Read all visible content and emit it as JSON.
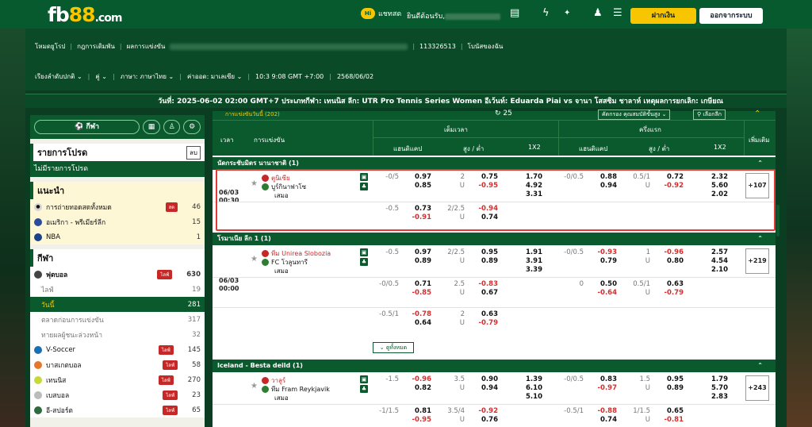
{
  "header": {
    "logo_prefix": "fb",
    "logo_num": "88",
    "logo_suffix": ".com",
    "chat_bubble": "Hi",
    "chat_label": "แชทสด",
    "welcome": "ยินดีต้อนรับ,",
    "deposit_label": "ฝากเงิน",
    "logout_label": "ออกจากระบบ",
    "icons": [
      "wallet-icon",
      "bolt-icon",
      "promo-icon",
      "user-icon",
      "list-icon",
      "menu-icon"
    ]
  },
  "nav": {
    "row1": [
      "โหมดยูโรป",
      "กฎการเดิมพัน",
      "ผลการแข่งขัน"
    ],
    "account_id": "113326513",
    "my_bets": "โบนัสของฉัน",
    "row2": [
      "เรียงลำดับปกติ",
      "คู่",
      "ภาษา: ภาษาไทย",
      "ค่าออด: มาเลเซีย",
      "10:3 9:08 GMT +7:00",
      "2568/06/02"
    ]
  },
  "match_bar": "วันที่: 2025-06-02 02:00 GMT+7 ประเภทกีฬา: เทนนิส ลีก: UTR Pro Tennis Series Women อีเว้นท์: Eduarda Piai vs จานา โสสซิม ชาลาห์ เหตุผลการยกเลิก: เกษียณ",
  "sidebar": {
    "sports_label": "กีฬา",
    "my_bets_title": "รายการโปรด",
    "clear_label": "ลบ",
    "no_favorites": "ไม่มีรายการโปรด",
    "recommend_title": "แนะนำ",
    "recommend": [
      {
        "label": "การถ่ายทอดสดทั้งหมด",
        "badge": "สด",
        "count": "46"
      },
      {
        "label": "อเมริกา - พรีเมียร์ลีก",
        "count": "15"
      },
      {
        "label": "NBA",
        "count": "1"
      }
    ],
    "sports_title": "กีฬา",
    "sports": [
      {
        "label": "ฟุตบอล",
        "badge": "ไลฟ์",
        "count": "630",
        "bold": true
      },
      {
        "label": "ไลฟ์",
        "count": "19",
        "sub": true
      },
      {
        "label": "วันนี้",
        "count": "281",
        "sub": true,
        "active": true
      },
      {
        "label": "ตลาดก่อนการแข่งขัน",
        "count": "317",
        "sub": true
      },
      {
        "label": "ทายผลผู้ชนะล่วงหน้า",
        "count": "32",
        "sub": true
      },
      {
        "label": "V-Soccer",
        "badge": "ไลฟ์",
        "count": "145"
      },
      {
        "label": "บาสเกตบอล",
        "badge": "ไลฟ์",
        "count": "58"
      },
      {
        "label": "เทนนิส",
        "badge": "ไลฟ์",
        "count": "270"
      },
      {
        "label": "เบสบอล",
        "badge": "ไลฟ์",
        "count": "23"
      },
      {
        "label": "อี-สปอร์ต",
        "badge": "ไลฟ์",
        "count": "65"
      }
    ]
  },
  "table": {
    "top_label": "การแข่งขันวันนี้ (202)",
    "refresh": "25",
    "sort_label": "คัดกรอง คุณสมบัติขั้นสูง",
    "select_label": "เลือกลีก",
    "col_time": "เวลา",
    "col_match": "การแข่งขัน",
    "col_full": "เต็มเวลา",
    "col_half": "ครึ่งแรก",
    "col_more": "เพิ่มเติม",
    "sub_hdp": "แฮนดิแคป",
    "sub_ou": "สูง / ต่ำ",
    "sub_1x2": "1X2",
    "draw": "เสมอ",
    "expand_label": "ดูทั้งหมด"
  },
  "leagues": [
    {
      "name": "นัดกระชับมิตร นานาชาติ (1)",
      "date": "06/03",
      "time": "00:30",
      "home": "ตูนิเซีย",
      "away": "บูร์กินาฟาโซ",
      "more": "+107",
      "rows": [
        {
          "fh": "-0/5",
          "fho1": "0.97",
          "fho2": "0.85",
          "fou": "2",
          "fou2": "U",
          "fouo1": "0.75",
          "fouo2": "-0.95",
          "x1": "1.70",
          "x2": "4.92",
          "x3": "3.31",
          "hh": "-0/0.5",
          "hho1": "0.88",
          "hho2": "0.94",
          "hou": "0.5/1",
          "hou2": "U",
          "houo1": "0.72",
          "houo2": "-0.92",
          "hx1": "2.32",
          "hx2": "5.60",
          "hx3": "2.02"
        },
        {
          "fh": "-0.5",
          "fho1": "0.73",
          "fho2": "-0.91",
          "fou": "2/2.5",
          "fou2": "U",
          "fouo1": "-0.94",
          "fouo2": "0.74"
        }
      ]
    },
    {
      "name": "โรมาเนีย ลีก 1 (1)",
      "date": "06/03",
      "time": "00:00",
      "home": "ทีม Unirea Slobozia",
      "away": "FC โวลูนทารี",
      "more": "+219",
      "rows": [
        {
          "fh": "-0.5",
          "fho1": "0.97",
          "fho2": "0.89",
          "fou": "2/2.5",
          "fou2": "U",
          "fouo1": "0.95",
          "fouo2": "0.89",
          "x1": "1.91",
          "x2": "3.91",
          "x3": "3.39",
          "hh": "-0/0.5",
          "hho1": "-0.93",
          "hho2": "0.79",
          "hou": "1",
          "hou2": "U",
          "houo1": "-0.96",
          "houo2": "0.80",
          "hx1": "2.57",
          "hx2": "4.54",
          "hx3": "2.10"
        },
        {
          "fh": "-0/0.5",
          "fho1": "0.71",
          "fho2": "-0.85",
          "fou": "2.5",
          "fou2": "U",
          "fouo1": "-0.83",
          "fouo2": "0.67",
          "hh": "0",
          "hho1": "0.50",
          "hho2": "-0.64",
          "hou": "0.5/1",
          "hou2": "U",
          "houo1": "0.63",
          "houo2": "-0.79"
        },
        {
          "fh": "-0.5/1",
          "fho1": "-0.78",
          "fho2": "0.64",
          "fou": "2",
          "fou2": "U",
          "fouo1": "0.63",
          "fouo2": "-0.79"
        }
      ]
    },
    {
      "name": "Iceland - Besta deild (1)",
      "date": "",
      "time": "",
      "home": "วาลูร์",
      "away": "ทีม Fram Reykjavik",
      "more": "+243",
      "rows": [
        {
          "fh": "-1.5",
          "fho1": "-0.96",
          "fho2": "0.82",
          "fou": "3.5",
          "fou2": "U",
          "fouo1": "0.90",
          "fouo2": "0.94",
          "x1": "1.39",
          "x2": "6.10",
          "x3": "5.10",
          "hh": "-0/0.5",
          "hho1": "0.83",
          "hho2": "-0.97",
          "hou": "1.5",
          "hou2": "U",
          "houo1": "0.95",
          "houo2": "0.89",
          "hx1": "1.79",
          "hx2": "5.70",
          "hx3": "2.83"
        },
        {
          "fh": "-1/1.5",
          "fho1": "0.81",
          "fho2": "-0.95",
          "fou": "3.5/4",
          "fou2": "U",
          "fouo1": "-0.92",
          "fouo2": "0.76",
          "hh": "-0.5/1",
          "hho1": "-0.88",
          "hho2": "0.74",
          "hou": "1/1.5",
          "hou2": "U",
          "houo1": "0.65",
          "houo2": "-0.81"
        }
      ]
    }
  ]
}
